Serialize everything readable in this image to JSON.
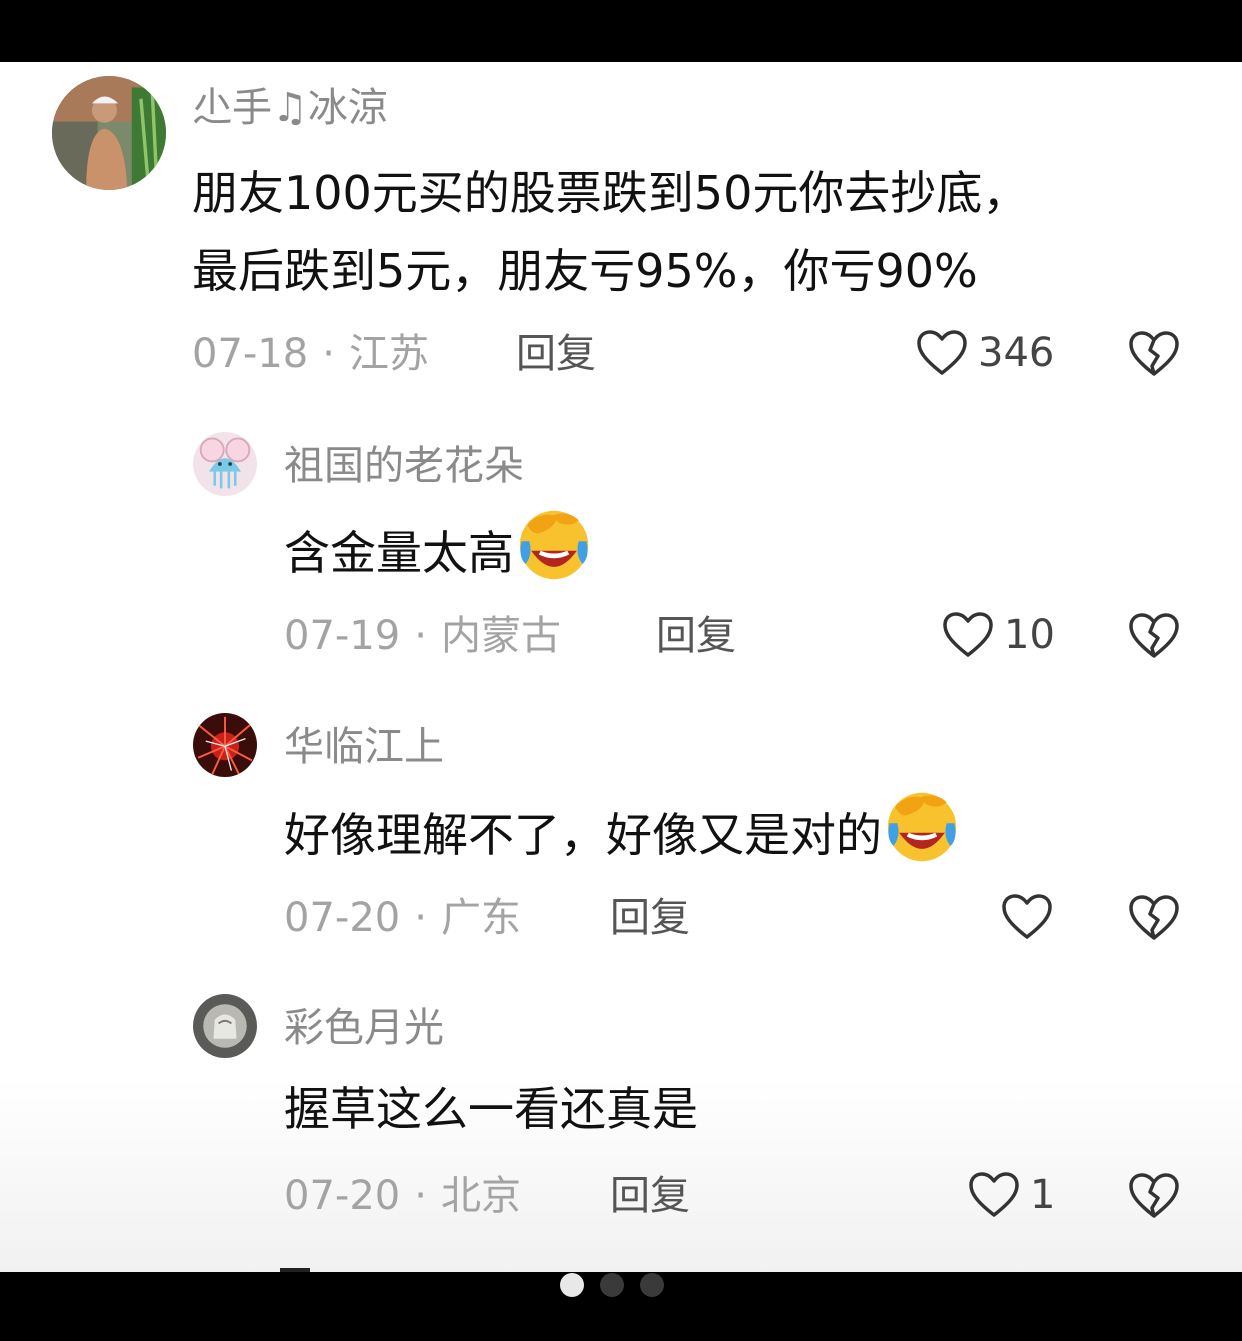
{
  "comments": [
    {
      "username": "尐手♫冰涼",
      "lines": [
        "朋友100元买的股票跌到50元你去抄底，",
        "最后跌到5元，朋友亏95%，你亏90%"
      ],
      "date": "07-18",
      "location": "江苏",
      "reply_label": "回复",
      "likes": "346",
      "avatar": "man-portrait",
      "level": 0
    },
    {
      "username": "祖国的老花朵",
      "lines": [
        "含金量太高"
      ],
      "emoji": "laughing-tears-emoji",
      "date": "07-19",
      "location": "内蒙古",
      "reply_label": "回复",
      "likes": "10",
      "avatar": "cartoon-jellyfish",
      "level": 1
    },
    {
      "username": "华临江上",
      "lines": [
        "好像理解不了，好像又是对的"
      ],
      "emoji": "laughing-tears-emoji",
      "date": "07-20",
      "location": "广东",
      "reply_label": "回复",
      "likes": "",
      "avatar": "red-fireworks",
      "level": 1
    },
    {
      "username": "彩色月光",
      "lines": [
        "握草这么一看还真是"
      ],
      "date": "07-20",
      "location": "北京",
      "reply_label": "回复",
      "likes": "1",
      "avatar": "grey-object",
      "level": 1
    }
  ],
  "separator": "·",
  "icons": {
    "like": "heart-outline-icon",
    "dislike": "broken-heart-icon"
  },
  "pager": {
    "count": 3,
    "active": 0
  },
  "colors": {
    "username": "#8a8a8a",
    "text": "#111111",
    "meta": "#a3a3a3",
    "reply": "#555555"
  }
}
